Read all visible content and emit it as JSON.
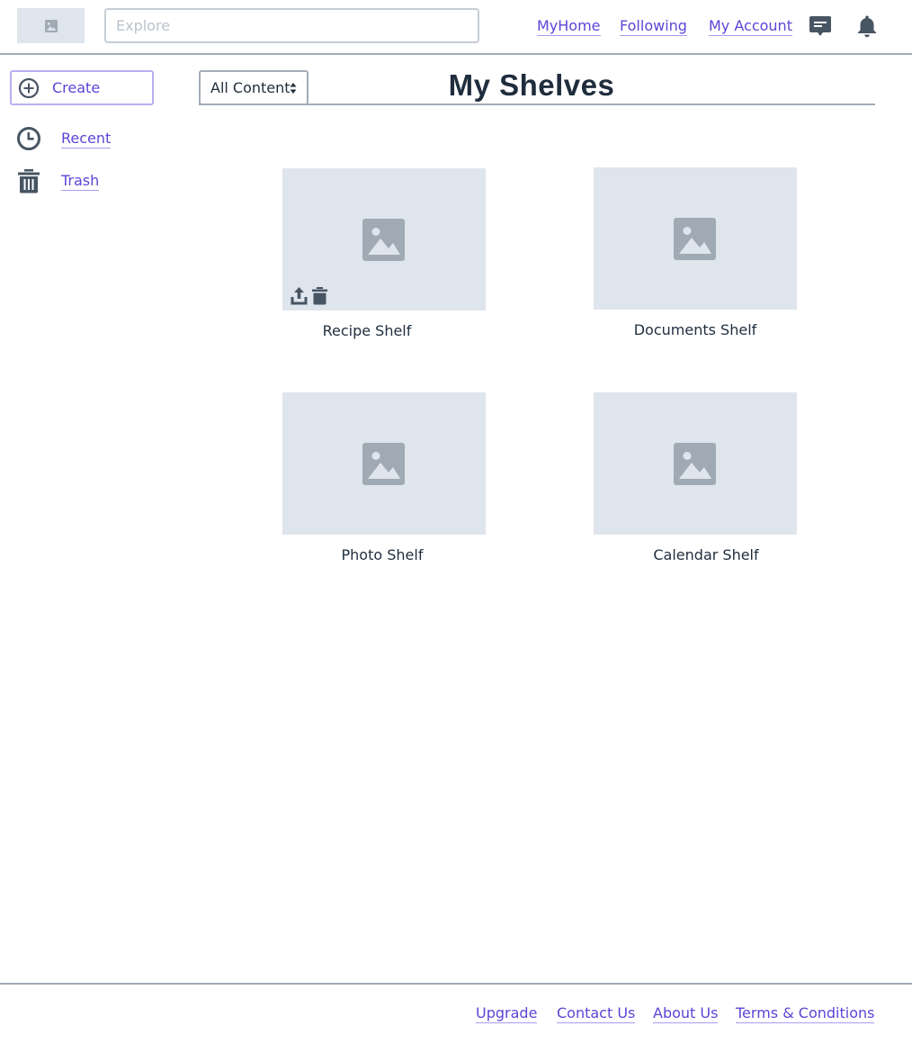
{
  "header": {
    "search_placeholder": "Explore",
    "nav": {
      "myhome": "MyHome",
      "following": "Following",
      "my_account": "My Account"
    },
    "icons": [
      "image-icon",
      "chat-icon",
      "bell-icon"
    ]
  },
  "sidebar": {
    "create_label": "Create",
    "items": [
      {
        "label": "Recent",
        "icon": "clock-icon"
      },
      {
        "label": "Trash",
        "icon": "trash-icon"
      }
    ]
  },
  "main": {
    "filter_value": "All Content",
    "title": "My Shelves",
    "shelves": [
      {
        "name": "Recipe Shelf",
        "actions": [
          "share-icon",
          "delete-icon"
        ]
      },
      {
        "name": "Documents Shelf"
      },
      {
        "name": "Photo Shelf"
      },
      {
        "name": "Calendar Shelf"
      }
    ]
  },
  "footer": {
    "links": [
      "Upgrade",
      "Contact Us",
      "About Us",
      "Terms & Conditions"
    ]
  },
  "colors": {
    "accent": "#5b45d6",
    "text": "#1f2d3d",
    "placeholder_bg": "#dfe5ec",
    "icon_gray": "#a0aab4",
    "divider": "#a3acb7"
  }
}
